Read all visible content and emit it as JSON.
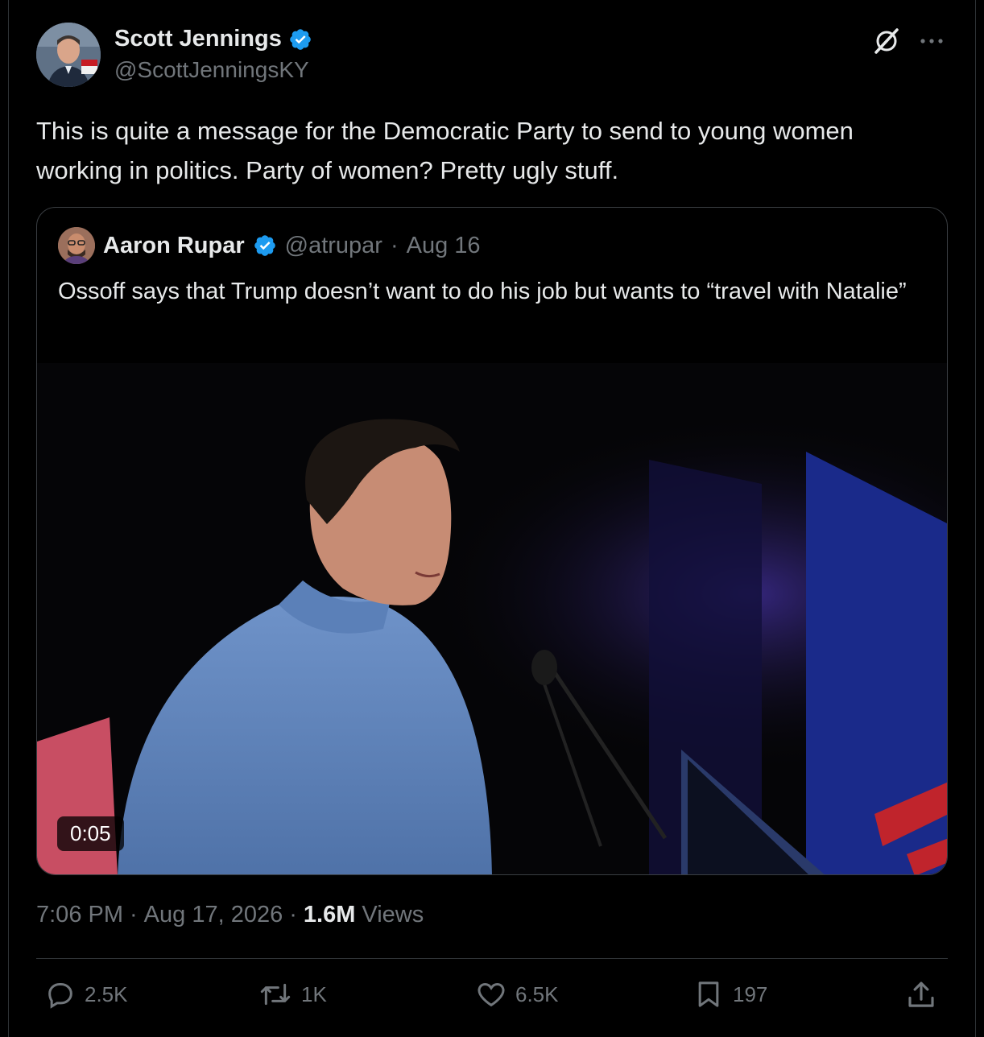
{
  "author": {
    "display_name": "Scott Jennings",
    "handle": "@ScottJenningsKY",
    "verified_icon": "verified-badge-icon"
  },
  "tweet": {
    "text": "This is quite a message for the Democratic Party to send to young women working in politics. Party of women? Pretty ugly stuff."
  },
  "quoted": {
    "display_name": "Aaron Rupar",
    "handle": "@atrupar",
    "separator": "·",
    "date": "Aug 16",
    "text": "Ossoff says that Trump doesn’t want to do his job but wants to “travel with Natalie”",
    "video_duration": "0:05"
  },
  "meta": {
    "time": "7:06 PM",
    "sep1": "·",
    "date": "Aug 17, 2026",
    "sep2": "·",
    "views_count": "1.6M",
    "views_label": "Views"
  },
  "actions": {
    "replies": "2.5K",
    "reposts": "1K",
    "likes": "6.5K",
    "bookmarks": "197"
  },
  "colors": {
    "background": "#000000",
    "text": "#e7e9ea",
    "muted": "#71767b",
    "verified": "#1d9bf0",
    "border": "#2f3336"
  }
}
